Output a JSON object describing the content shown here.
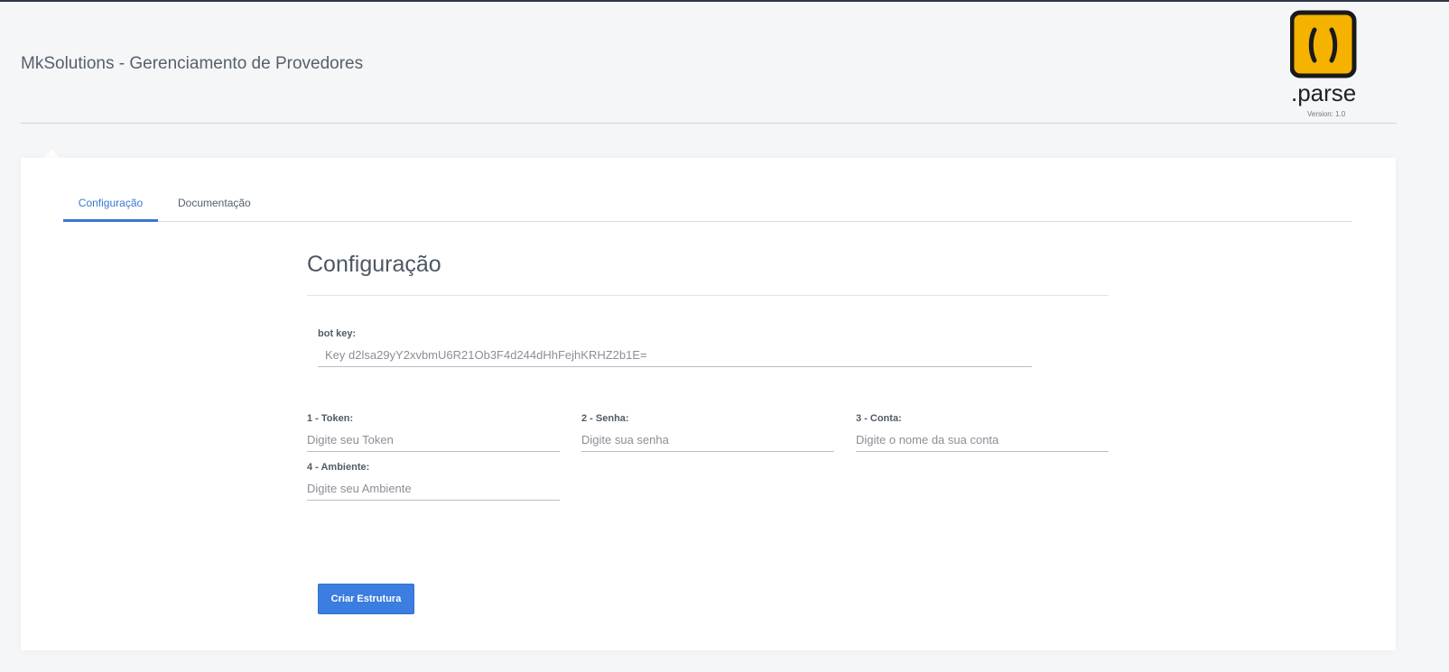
{
  "header": {
    "title": "MkSolutions - Gerenciamento de Provedores",
    "logo_text": ".parse",
    "version": "Version: 1.0"
  },
  "tabs": [
    {
      "label": "Configuração",
      "active": true
    },
    {
      "label": "Documentação",
      "active": false
    }
  ],
  "form": {
    "section_title": "Configuração",
    "bot_key": {
      "label": "bot key:",
      "placeholder": "Key d2lsa29yY2xvbmU6R21Ob3F4d244dHhFejhKRHZ2b1E="
    },
    "token": {
      "label": "1 - Token:",
      "placeholder": "Digite seu Token"
    },
    "senha": {
      "label": "2 - Senha:",
      "placeholder": "Digite sua senha"
    },
    "conta": {
      "label": "3 - Conta:",
      "placeholder": "Digite o nome da sua conta"
    },
    "ambiente": {
      "label": "4 - Ambiente:",
      "placeholder": "Digite seu Ambiente"
    },
    "submit_label": "Criar Estrutura"
  },
  "colors": {
    "accent": "#3b7de0",
    "logo_yellow": "#f5b300"
  },
  "icons": {
    "logo": "parse-logo-icon"
  }
}
